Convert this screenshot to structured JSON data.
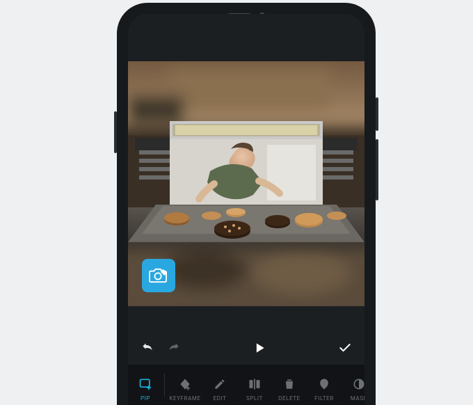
{
  "colors": {
    "accent": "#1bb3e0",
    "badge": "#29a7e0",
    "phone": "#171a1d",
    "screen": "#1c1f22"
  },
  "watermark": {
    "badge_icon": "camera-erase"
  },
  "transport": {
    "undo": "undo",
    "redo": "redo",
    "play": "play",
    "confirm": "confirm"
  },
  "toolbar": {
    "items": [
      {
        "id": "pip",
        "label": "PIP",
        "icon": "pip-add-icon",
        "active": true
      },
      {
        "id": "keyframe",
        "label": "KEYFRAME",
        "icon": "keyframe-icon"
      },
      {
        "id": "edit",
        "label": "EDIT",
        "icon": "pencil-icon"
      },
      {
        "id": "split",
        "label": "SPLIT",
        "icon": "split-icon"
      },
      {
        "id": "delete",
        "label": "DELETE",
        "icon": "trash-icon"
      },
      {
        "id": "filter",
        "label": "FILTER",
        "icon": "filter-blob-icon"
      },
      {
        "id": "mask",
        "label": "MASK",
        "icon": "mask-icon"
      }
    ]
  }
}
